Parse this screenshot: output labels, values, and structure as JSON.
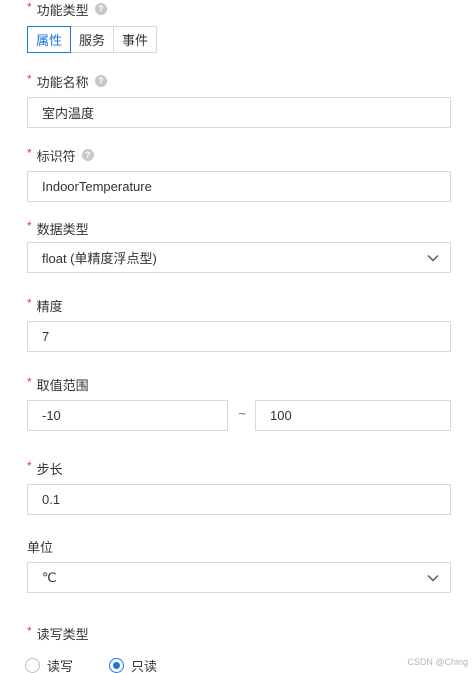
{
  "func_type": {
    "label": "功能类型",
    "options": [
      "属性",
      "服务",
      "事件"
    ],
    "selected": "属性"
  },
  "func_name": {
    "label": "功能名称",
    "value": "室内温度"
  },
  "identifier": {
    "label": "标识符",
    "value": "IndoorTemperature"
  },
  "data_type": {
    "label": "数据类型",
    "value": "float (单精度浮点型)"
  },
  "precision": {
    "label": "精度",
    "value": "7"
  },
  "range": {
    "label": "取值范围",
    "min": "-10",
    "separator": "~",
    "max": "100"
  },
  "step": {
    "label": "步长",
    "value": "0.1"
  },
  "unit": {
    "label": "单位",
    "value": "℃"
  },
  "rw_type": {
    "label": "读写类型",
    "options": [
      "读写",
      "只读"
    ],
    "selected": "只读"
  },
  "required_mark": "*",
  "help_icon": "?",
  "watermark": "CSDN @Ching",
  "colors": {
    "accent": "#1a73e8",
    "required": "#e03c3c",
    "border": "#d9d9d9"
  }
}
